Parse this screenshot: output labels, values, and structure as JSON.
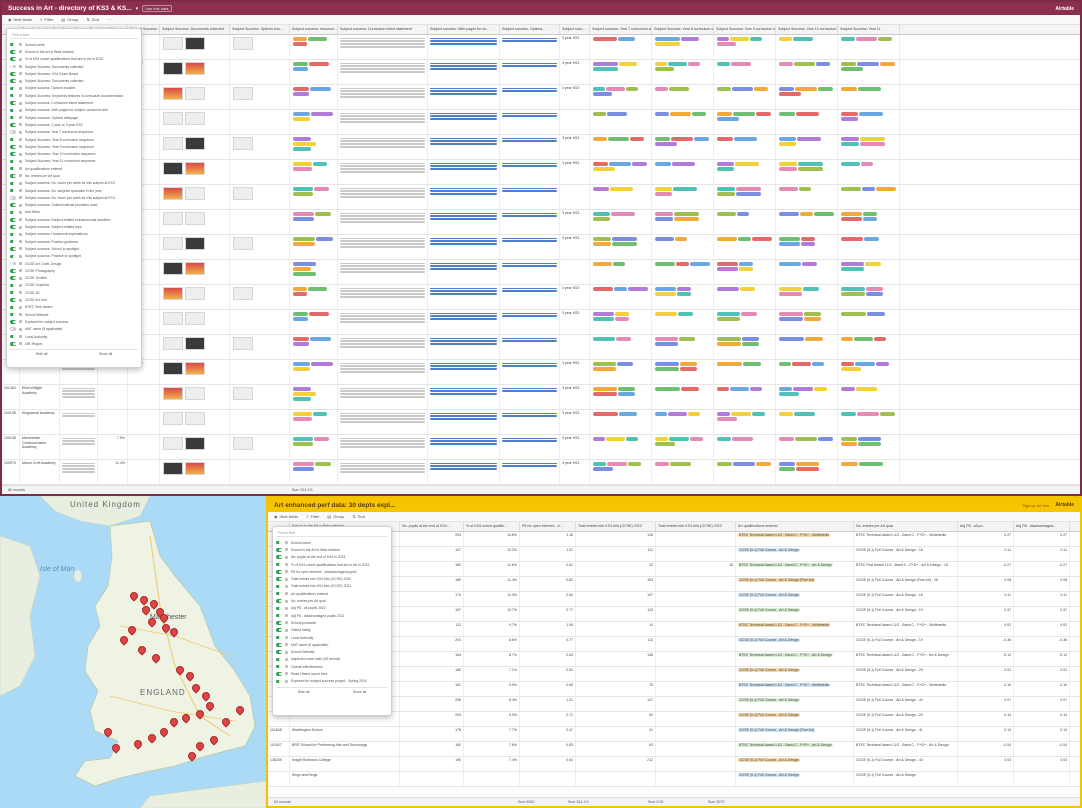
{
  "top_window": {
    "title": "Success in Art - directory of KS3 & KS...",
    "share_label": "Use this data",
    "brand": "Airtable",
    "toolbar": {
      "hide_fields": "Hide fields",
      "filter": "Filter",
      "group": "Group",
      "sort": "Sort"
    },
    "columns": [
      "",
      "School in the Art in Beta...",
      "Subject Success Resour...",
      "% of KS4 cohort qualific...",
      "Subject Success: KS4 Ar...",
      "Subject Success: Documents collected",
      "Subject Success: Options boo...",
      "Subject success: resource...",
      "Subject success: Curriculum intent statement",
      "Subject success: Web pages for su...",
      "Subject success: Options...",
      "Subject succ...",
      "Subject success: Year 7 curriculum sequence",
      "Subject Success: Year 8 curriculum sequence",
      "Subject Success: Year 9 curriculum sequence",
      "Subject Success: Year 10 curriculum sequence",
      "Subject Success: Year 11"
    ],
    "rows_visible": [
      {
        "num": "",
        "school": "",
        "yes": false,
        "pct": "9.4%",
        "syl": "AQA",
        "ofsted": "3 year KS3"
      },
      {
        "num": "",
        "school": "",
        "yes": true,
        "pct": "9.4%",
        "syl": "Edexcel",
        "ofsted": "3 year KS3"
      },
      {
        "num": "",
        "school": "",
        "yes": true,
        "pct": "6.4%",
        "syl": "Edexcel",
        "ofsted": "3 year KS3"
      },
      {
        "num": "",
        "school": "",
        "yes": false,
        "pct": "7.5%",
        "syl": "",
        "ofsted": ""
      },
      {
        "num": "",
        "school": "",
        "yes": false,
        "pct": "6.6%",
        "syl": "OCR",
        "ofsted": "3 year KS3"
      },
      {
        "num": "",
        "school": "",
        "yes": false,
        "pct": "",
        "syl": "AQA",
        "ofsted": "3 year KS3"
      },
      {
        "num": "",
        "school": "",
        "yes": false,
        "pct": "",
        "syl": "",
        "ofsted": ""
      },
      {
        "num": "",
        "school": "",
        "yes": false,
        "pct": "16.2%",
        "syl": "AQA",
        "ofsted": "3 year KS3"
      },
      {
        "num": "",
        "school": "",
        "yes": false,
        "pct": "",
        "syl": "",
        "ofsted": "3 year KS3"
      },
      {
        "num": "",
        "school": "",
        "yes": false,
        "pct": "9.7%",
        "syl": "AQA",
        "ofsted": ""
      },
      {
        "num": "",
        "school": "",
        "yes": false,
        "pct": "6.6%",
        "syl": "OCR",
        "ofsted": "3 year KS3"
      },
      {
        "num": "",
        "school": "",
        "yes": false,
        "pct": "6.6%",
        "syl": "AQA",
        "ofsted": "3 year KS3"
      },
      {
        "num": "",
        "school": "",
        "yes": false,
        "pct": "12.2%",
        "syl": "",
        "ofsted": ""
      },
      {
        "num": "",
        "school": "",
        "yes": false,
        "pct": "6.7%",
        "syl": "Edexcel",
        "ofsted": "3 year KS3"
      },
      {
        "num": "101464",
        "school": "Elliot Wittight Academy",
        "yes": false,
        "pct": "",
        "syl": "",
        "ofsted": "3 year KS3"
      },
      {
        "num": "100138",
        "school": "Kingswood Academy",
        "yes": false,
        "pct": "",
        "syl": "",
        "ofsted": "3 year KS3"
      },
      {
        "num": "100138",
        "school": "Manchester Communication Academy",
        "yes": false,
        "pct": "7.5%",
        "syl": "",
        "ofsted": "3 year KS3"
      },
      {
        "num": "100976",
        "school": "Manor Croft Academy",
        "yes": false,
        "pct": "11.4%",
        "syl": "",
        "ofsted": "3 year KS3"
      }
    ],
    "footer_count": "80 records",
    "footer_sum": "Sum 291.1%",
    "hide_popup": {
      "search_placeholder": "Find a field",
      "fields": [
        "School name",
        "School in the Art in Beta network",
        "% of KS4 cohort qualifications that are in Art in 2022",
        "Subject Success: Documents collected",
        "Subject Success: KS4 Exam Board",
        "Subject Success: Documents collected",
        "Subject success: Options booklet",
        "Subject Success: Keywords features in curriculum documentation",
        "Subject success: Curriculum intent statement",
        "Subject success: Web pages for subject curriculum info",
        "Subject success: Options webpage",
        "Subject success: 2 year or 3 year KS3",
        "Subject success: Year 7 curriculum sequence",
        "Subject Success: Year 8 curriculum sequence",
        "Subject Success: Year 9 curriculum sequence",
        "Subject Success: Year 10 curriculum sequence",
        "Subject Success: Year 11 curriculum sequence",
        "Art qualifications entered",
        "No. entries per Art qual",
        "Subject success: No. hours per week for this subject at KS3",
        "Subject success: No. subjects specialist in the year",
        "Subject success: No. hours per week for this subject at KS4",
        "Subject success: Online/external providers used",
        "Add fields",
        "Subject success: Subject-related extracurricular activities",
        "Subject success: Subject-related trips",
        "Subject success: Homework expectations",
        "Subject success: Position guidance",
        "Subject success: School to spotlight",
        "Subject success: Practice to spotlight",
        "GCSE Art: Craft, Design",
        "GCSE Photography",
        "GCSE Textiles",
        "GCSE Graphics",
        "GCSE 3D",
        "GCSE Art Unit",
        "BTEC Tech Award",
        "School Website",
        "Explored for subject success",
        "MAT name (if applicable)",
        "Local Authority",
        "DfE Region"
      ],
      "show_all": "Hide all",
      "hide_all": "Show all"
    }
  },
  "bottom_window": {
    "title": "Art enhanced perf data: 30 depts expl...",
    "signup": "Sign up for free",
    "brand": "Airtable",
    "toolbar": {
      "hide_fields": "Hide fields",
      "filter": "Filter",
      "group": "Group",
      "sort": "Sort"
    },
    "columns": [
      "",
      "School in the Art in Beta network",
      "No. pupils at the end of KS4...",
      "% of KS4 cohort qualific...",
      "P8 for open element - d...",
      "Total entries into KS4 Arts (GCSE) 2022",
      "Total entries into KS4 Arts (GCSE) 2023",
      "Art qualifications entered",
      "No. entries per Art qual",
      "Adj P8 - all pu...",
      "Adj P8 - disadvantaged..."
    ],
    "rows": [
      {
        "num": "",
        "school": "",
        "yes": false,
        "pupils": "204",
        "pct": "14.8%",
        "p8": "1.18",
        "e22": "128",
        "e23": "",
        "qual": "BTEC Technical Award L1/2 - Band C - P+D+ - Multimedia",
        "per": "BTEC Technical Award L1/2 - Band C - P+D+ - Multimedia",
        "adj": "0.27"
      },
      {
        "num": "",
        "school": "",
        "yes": true,
        "pupils": "107",
        "pct": "10.2%",
        "p8": "1.01",
        "e22": "111",
        "e23": "",
        "qual": "GCSE (9-1) Full Course - Art & Design",
        "per": "GCSE (9-1) Full Course - Art & Design - 16",
        "adj": "0.11"
      },
      {
        "num": "",
        "school": "",
        "yes": true,
        "pupils": "160",
        "pct": "11.6%",
        "p8": "0.61",
        "e22": "22",
        "e23": "18",
        "qual": "BTEC Technical Award L1/2 - Band C - P+D+ - Art & Design",
        "per": "BTEC First Award L1/2 - Band C - P+D+ - Art & Design - 18",
        "adj": "-0.27"
      },
      {
        "num": "",
        "school": "",
        "yes": false,
        "pupils": "189",
        "pct": "11.4%",
        "p8": "0.82",
        "e22": "153",
        "e23": "",
        "qual": "GCSE (9-1) Full Course - Art & Design (Fine Art)",
        "per": "GCSE (9-1) Full Course - Art & Design (Fine Art) - 28",
        "adj": "0.08"
      },
      {
        "num": "",
        "school": "",
        "yes": true,
        "pupils": "173",
        "pct": "11.4%",
        "p8": "0.84",
        "e22": "107",
        "e23": "",
        "qual": "GCSE (9-1) Full Course - Art & Design",
        "per": "GCSE (9-1) Full Course - Art & Design - 16",
        "adj": "0.11"
      },
      {
        "num": "",
        "school": "",
        "yes": false,
        "pupils": "167",
        "pct": "10.7%",
        "p8": "0.77",
        "e22": "113",
        "e23": "",
        "qual": "GCSE (9-1) Full Course - Art & Design",
        "per": "GCSE (9-1) Full Course - Art & Design - 19",
        "adj": "0.37"
      },
      {
        "num": "",
        "school": "",
        "yes": false,
        "pupils": "112",
        "pct": "9.7%",
        "p8": "1.06",
        "e22": "14",
        "e23": "",
        "qual": "BTEC Technical Award L1/2 - Band C - P+D+ - Multimedia",
        "per": "BTEC Technical Award L1/2 - Band C - P+D+ - Multimedia",
        "adj": "0.02"
      },
      {
        "num": "",
        "school": "",
        "yes": true,
        "pupils": "203",
        "pct": "8.6%",
        "p8": "0.77",
        "e22": "113",
        "e23": "",
        "qual": "GCSE (9-1) Full Course - Art & Design",
        "per": "GCSE (9-1) Full Course - Art & Design - 19",
        "adj": "-0.36"
      },
      {
        "num": "",
        "school": "",
        "yes": true,
        "pupils": "164",
        "pct": "8.7%",
        "p8": "0.63",
        "e22": "145",
        "e23": "",
        "qual": "BTEC Technical Award L1/2 - Band C - P+D+ - Art & Design",
        "per": "BTEC Technical Award L1/2 - Band C - P+D+ - Art & Design",
        "adj": "-0.12"
      },
      {
        "num": "",
        "school": "",
        "yes": false,
        "pupils": "166",
        "pct": "7.1%",
        "p8": "0.54",
        "e22": "",
        "e23": "",
        "qual": "GCSE (9-1) Full Course - Art & Design",
        "per": "GCSE (9-1) Full Course - Art & Design - 29",
        "adj": "0.02"
      },
      {
        "num": "",
        "school": "",
        "yes": false,
        "pupils": "161",
        "pct": "9.0%",
        "p8": "0.69",
        "e22": "75",
        "e23": "",
        "qual": "BTEC Technical Award L1/2 - Band C - P+D+ - Multimedia",
        "per": "BTEC Technical Award L1/2 - Band C - P+D+ - Multimedia",
        "adj": "0.16"
      },
      {
        "num": "",
        "school": "",
        "yes": false,
        "pupils": "205",
        "pct": "8.4%",
        "p8": "1.01",
        "e22": "127",
        "e23": "",
        "qual": "GCSE (9-1) Full Course - Art & Design",
        "per": "GCSE (9-1) Full Course - Art & Design - 44",
        "adj": "0.07"
      },
      {
        "num": "",
        "school": "The Charter Dickens School",
        "yes": false,
        "pupils": "203",
        "pct": "9.0%",
        "p8": "0.71",
        "e22": "54",
        "e23": "",
        "qual": "GCSE (9-1) Full Course - Art & Design",
        "per": "GCSE (9-1) Full Course - Art & Design - 24",
        "adj": "0.10"
      },
      {
        "num": "101648",
        "school": "Worthington School",
        "yes": false,
        "pupils": "178",
        "pct": "7.7%",
        "p8": "0.47",
        "e22": "41",
        "e23": "",
        "qual": "GCSE (9-1) Full Course - Art & Design (Fine Art)",
        "per": "GCSE (9-1) Full Course - Art & Design - 41",
        "adj": "0.13"
      },
      {
        "num": "101547",
        "school": "BRIT School for Performing Arts and Technology",
        "yes": false,
        "pupils": "160",
        "pct": "7.6%",
        "p8": "0.83",
        "e22": "63",
        "e23": "",
        "qual": "BTEC Technical Award L1/2 - Band C - P+D+ - Art & Design",
        "per": "BTEC Technical Award L1/2 - Band C - P+D+ - Art & Design",
        "adj": "-0.04"
      },
      {
        "num": "148235",
        "school": "Knight Robinson College",
        "yes": false,
        "pupils": "195",
        "pct": "7.4%",
        "p8": "0.63",
        "e22": "212",
        "e23": "",
        "qual": "GCSE (9-1) Full Course - Art & Design",
        "per": "GCSE (9-1) Full Course - Art & Design - 43",
        "adj": "0.03"
      },
      {
        "num": "",
        "school": "Kings and Kings",
        "yes": false,
        "pupils": "",
        "pct": "",
        "p8": "",
        "e22": "",
        "e23": "",
        "qual": "GCSE (9-1) Full Course - Art & Design",
        "per": "GCSE (9-1) Full Course - Art & Design",
        "adj": ""
      }
    ],
    "footer_count": "60 records",
    "footer_sums": [
      "Sum 5952",
      "Sum 261.1%",
      "Sum 0.05",
      "Sum 3073"
    ],
    "hide_popup": {
      "search_placeholder": "Find a field",
      "fields": [
        "School name",
        "School in the Art in Beta network",
        "No. pupils at the end of KS4 in 2023",
        "% of KS4 cohort qualifications that are in Art in 2022",
        "P8 for open element - disadvantaged pupils",
        "Total entries into KS4 Arts (GCSE) 2022",
        "Total entries into KS4 Arts (GCSE) 2023",
        "Art qualifications entered",
        "No. entries per Art qual",
        "Adj P8 - all pupils 2022",
        "Adj P8 - disadvantaged pupils 2021",
        "School postcode",
        "Ofsted rating",
        "Local Authority",
        "MAT name (if applicable)",
        "School Website",
        "Inspection start date (US format)",
        "Overall effectiveness",
        "Read Ofsted report here",
        "Explored for subject success project - Spring 2024"
      ],
      "show_all": "Hide all",
      "hide_all": "Show all"
    }
  },
  "map": {
    "labels": {
      "country1": "United Kingdom",
      "country2": "ENGLAND",
      "sea": "Isle of Man",
      "city": "Manchester"
    }
  },
  "colors": {
    "top_header": "#8b2f4d",
    "bottom_header": "#f6c400",
    "yes_badge": "#2f9a4a",
    "pin": "#e04444"
  }
}
